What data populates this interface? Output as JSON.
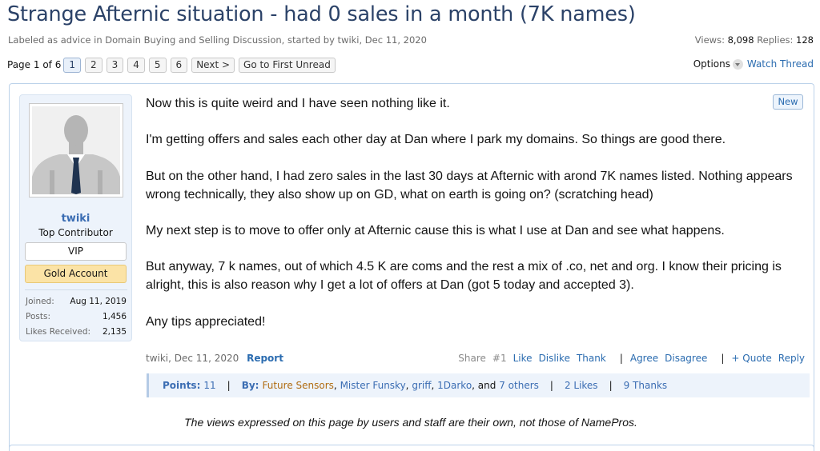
{
  "thread": {
    "title": "Strange Afternic situation - had 0 sales in a month (7K names)",
    "meta": "Labeled as advice in Domain Buying and Selling Discussion, started by twiki, Dec 11, 2020",
    "views_label": "Views:",
    "views_value": "8,098",
    "replies_label": "Replies:",
    "replies_value": "128"
  },
  "pagination": {
    "label": "Page 1 of 6",
    "pages": [
      "1",
      "2",
      "3",
      "4",
      "5",
      "6"
    ],
    "current": "1",
    "next_label": "Next >",
    "first_unread_label": "Go to First Unread"
  },
  "thread_tools": {
    "options_label": "Options",
    "watch_label": "Watch Thread"
  },
  "author": {
    "username": "twiki",
    "title": "Top Contributor",
    "badges": [
      "VIP",
      "Gold Account"
    ],
    "stats": [
      {
        "key": "Joined:",
        "value": "Aug 11, 2019"
      },
      {
        "key": "Posts:",
        "value": "1,456"
      },
      {
        "key": "Likes Received:",
        "value": "2,135"
      }
    ]
  },
  "post": {
    "new_tag": "New",
    "paragraphs": [
      "Now this is quite weird and I have seen nothing like it.",
      "I'm getting offers and sales each other day at Dan where I park my domains. So things are good there.",
      "But on the other hand, I had zero sales in the last 30 days at Afternic with arond 7K names listed. Nothing appears wrong technically, they also show up on GD, what on earth is going on? (scratching head)",
      "My next step is to move to offer only at Afternic cause this is what I use at Dan and see what happens.",
      "But anyway, 7 k names, out of which 4.5 K are coms and the rest a mix of .co, net and org. I know their pricing is alright, this is also reason why I get a lot of offers at Dan (got 5 today and accepted 3).",
      "Any tips appreciated!"
    ],
    "footer_meta": "twiki, Dec 11, 2020",
    "report_label": "Report",
    "share_label": "Share",
    "post_number": "#1",
    "like_label": "Like",
    "dislike_label": "Dislike",
    "thank_label": "Thank",
    "agree_label": "Agree",
    "disagree_label": "Disagree",
    "quote_label": "+ Quote",
    "reply_label": "Reply",
    "separator": "|"
  },
  "reactions": {
    "points_label": "Points:",
    "points_value": "11",
    "by_label": "By:",
    "names": [
      "Future Sensors",
      "Mister Funsky",
      "griff",
      "1Darko"
    ],
    "and_text": ", and",
    "others_label": "7 others",
    "likes_label": "2 Likes",
    "thanks_label": "9 Thanks",
    "comma": ","
  },
  "disclaimer": "The views expressed on this page by users and staff are their own, not those of NamePros.",
  "colors": {
    "title": "#2b4268",
    "link": "#2b6cb0",
    "gold_badge": "#fbe3a6",
    "gold_name": "#b06c11",
    "sidebar_bg": "#edf3fb"
  }
}
